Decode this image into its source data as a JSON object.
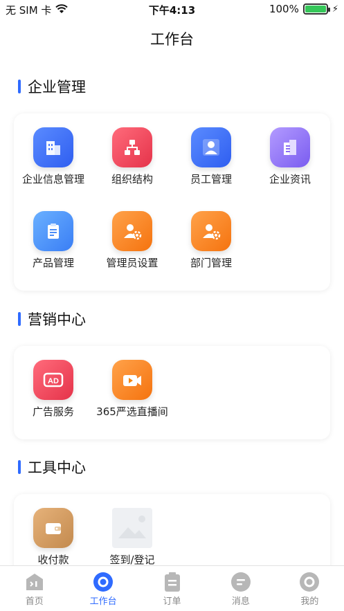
{
  "status": {
    "carrier": "无 SIM 卡",
    "time": "下午4:13",
    "battery": "100%",
    "battery_level": 1.0
  },
  "header": {
    "title": "工作台"
  },
  "sections": [
    {
      "title": "企业管理",
      "items": [
        {
          "label": "企业信息管理",
          "icon": "building-icon"
        },
        {
          "label": "组织结构",
          "icon": "org-chart-icon"
        },
        {
          "label": "员工管理",
          "icon": "employee-icon"
        },
        {
          "label": "企业资讯",
          "icon": "news-icon"
        },
        {
          "label": "产品管理",
          "icon": "clipboard-icon"
        },
        {
          "label": "管理员设置",
          "icon": "admin-settings-icon"
        },
        {
          "label": "部门管理",
          "icon": "department-icon"
        }
      ]
    },
    {
      "title": "营销中心",
      "items": [
        {
          "label": "广告服务",
          "icon": "ad-icon"
        },
        {
          "label": "365严选直播间",
          "icon": "video-camera-icon"
        }
      ]
    },
    {
      "title": "工具中心",
      "items": [
        {
          "label": "收付款",
          "icon": "wallet-icon"
        },
        {
          "label": "签到/登记",
          "icon": "image-placeholder-icon"
        }
      ]
    }
  ],
  "tabs": [
    {
      "label": "首页",
      "icon": "home-icon",
      "active": false
    },
    {
      "label": "工作台",
      "icon": "workbench-icon",
      "active": true
    },
    {
      "label": "订单",
      "icon": "order-icon",
      "active": false
    },
    {
      "label": "消息",
      "icon": "message-icon",
      "active": false
    },
    {
      "label": "我的",
      "icon": "profile-icon",
      "active": false
    }
  ],
  "colors": {
    "accent": "#2f6bff",
    "inactive": "#888888"
  }
}
